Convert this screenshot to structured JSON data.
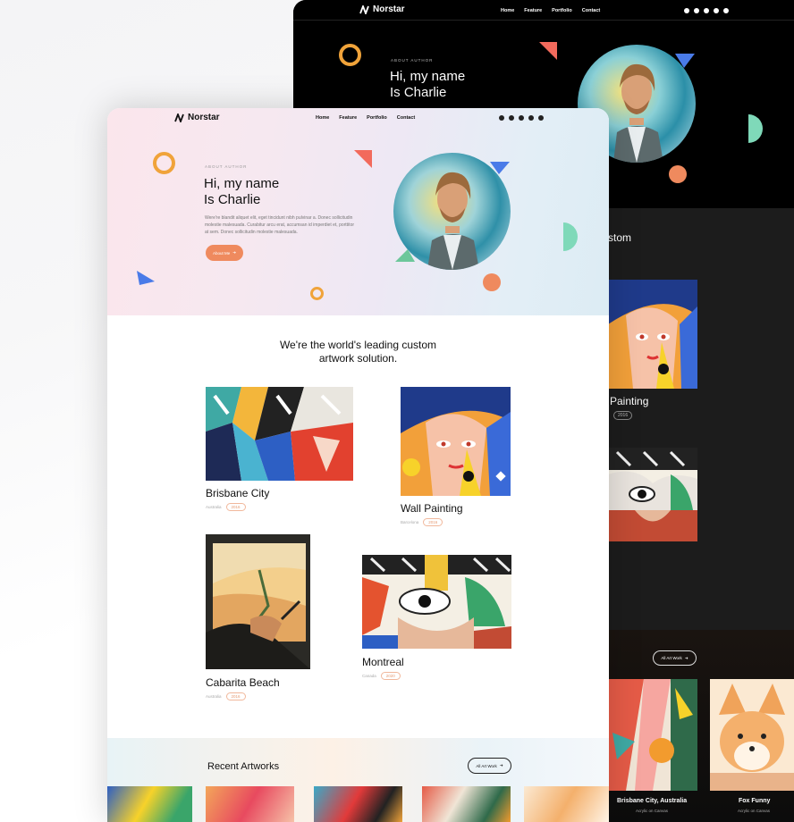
{
  "brand": {
    "name": "Norstar"
  },
  "nav": {
    "links": [
      "Home",
      "Feature",
      "Portfolio",
      "Contact"
    ]
  },
  "socials": [
    "facebook-icon",
    "twitter-icon",
    "dribbble-icon",
    "behance-icon",
    "pinterest-icon"
  ],
  "colors": {
    "accent": "#ef8a5e",
    "ring": "#f0a33a",
    "triangle_red": "#f26a5c",
    "triangle_blue": "#4a7be8",
    "mint": "#7fd9b9",
    "dark_bg": "#0a0a0a"
  },
  "hero": {
    "eyebrow": "ABOUT AUTHOR",
    "title_line1": "Hi, my name",
    "title_line2": "Is Charlie",
    "description": "Were're blandit aliquet elit, eget tincidunt nibh pulvinar a. Donec sollicitudin molestie malesuada. Curabitur arcu erat, accumsan id imperdiet et, porttitor at sem. Donec sollicitudin molestie malesuada.",
    "button_label": "About Me"
  },
  "portfolio": {
    "heading_line1": "We're the world's leading custom",
    "heading_line2": "artwork solution.",
    "items": [
      {
        "title": "Brisbane City",
        "location": "Australia",
        "year": "2016"
      },
      {
        "title": "Wall Painting",
        "location": "Barcelona",
        "year": "2016"
      },
      {
        "title": "Cabarita Beach",
        "location": "Australia",
        "year": "2016"
      },
      {
        "title": "Montreal",
        "location": "Canada",
        "year": "2020"
      }
    ]
  },
  "recent": {
    "title": "Recent Artworks",
    "button_label": "All Art Work"
  },
  "dark_preview": {
    "heading": "stom",
    "card_title": "Painting",
    "card_year": "2016",
    "button_label": "All Art Work",
    "cards": [
      {
        "title": "Brisbane City, Australia",
        "subtitle": "Acrylic on Canvas"
      },
      {
        "title": "Fox Funny",
        "subtitle": "Acrylic on Canvas"
      }
    ]
  }
}
